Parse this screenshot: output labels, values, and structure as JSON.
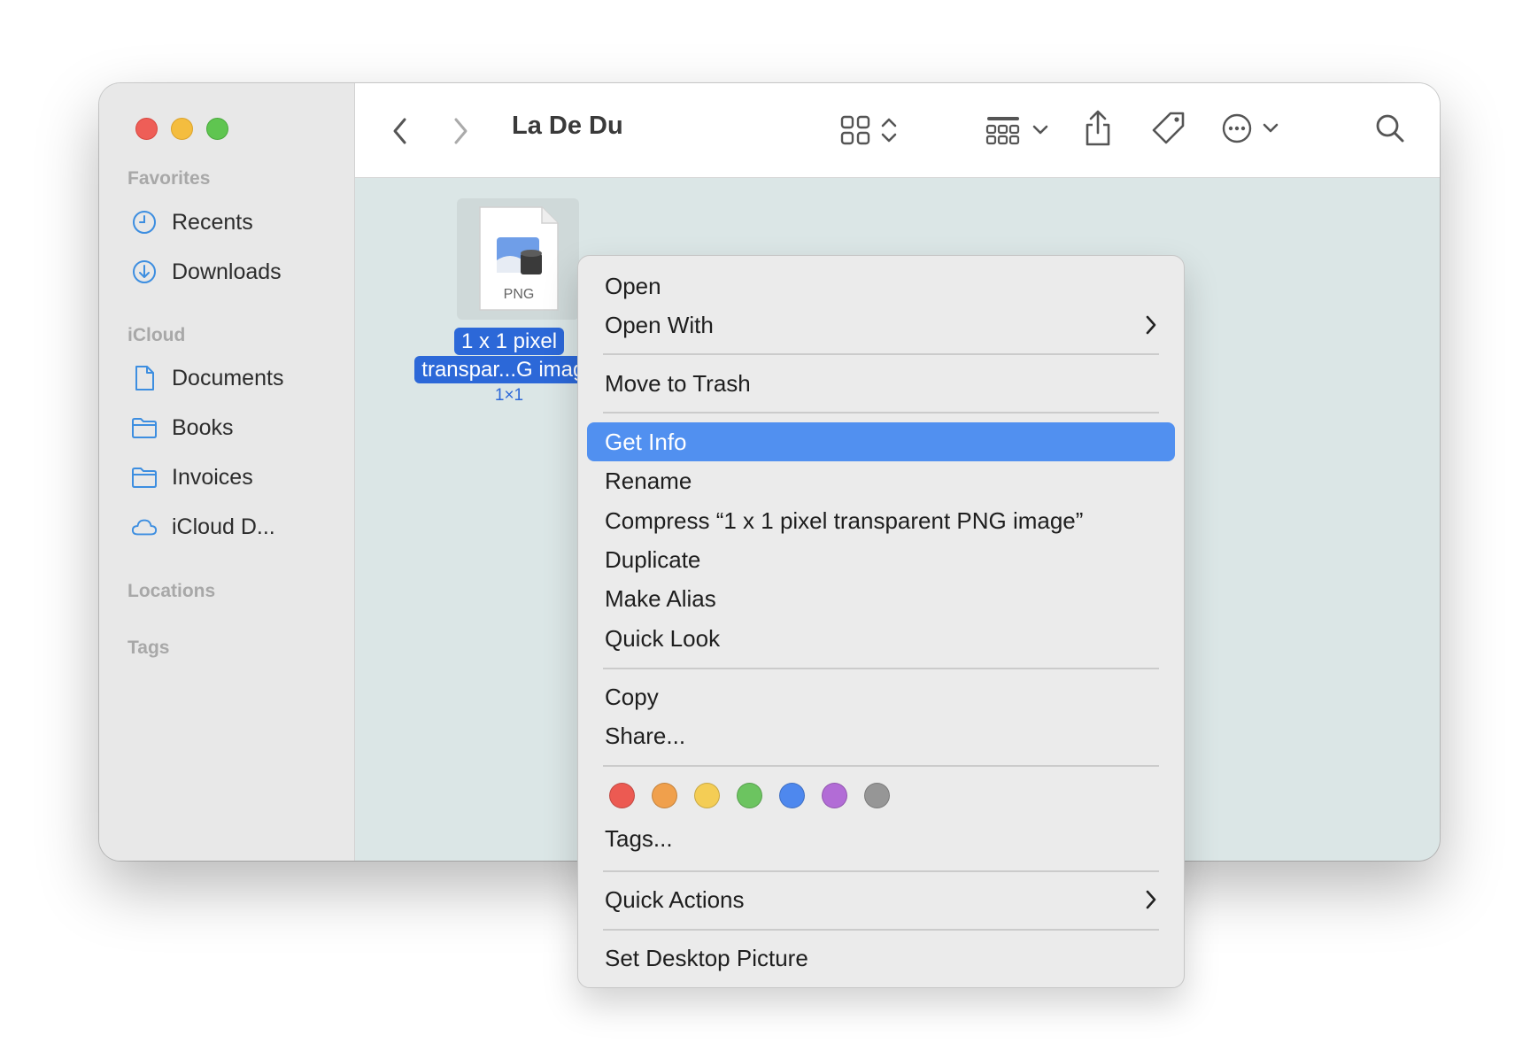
{
  "window": {
    "title": "La De Du"
  },
  "sidebar": {
    "sections": {
      "favorites": "Favorites",
      "icloud": "iCloud",
      "locations": "Locations",
      "tags": "Tags"
    },
    "favorites": [
      {
        "label": "Recents",
        "icon": "clock-icon"
      },
      {
        "label": "Downloads",
        "icon": "download-icon"
      }
    ],
    "icloud": [
      {
        "label": "Documents",
        "icon": "document-icon"
      },
      {
        "label": "Books",
        "icon": "folder-icon"
      },
      {
        "label": "Invoices",
        "icon": "folder-icon"
      },
      {
        "label": "iCloud D...",
        "icon": "cloud-icon"
      }
    ]
  },
  "file": {
    "type_label": "PNG",
    "name_line1": "1 x 1 pixel",
    "name_line2": "transpar...G image",
    "dimensions": "1×1"
  },
  "context_menu": {
    "open": "Open",
    "open_with": "Open With",
    "move_to_trash": "Move to Trash",
    "get_info": "Get Info",
    "rename": "Rename",
    "compress": "Compress “1 x 1 pixel transparent PNG image”",
    "duplicate": "Duplicate",
    "make_alias": "Make Alias",
    "quick_look": "Quick Look",
    "copy": "Copy",
    "share": "Share...",
    "tags": "Tags...",
    "quick_actions": "Quick Actions",
    "set_desktop_picture": "Set Desktop Picture",
    "highlighted": "Get Info",
    "tag_colors": [
      {
        "name": "red",
        "color": "#ec5a52"
      },
      {
        "name": "orange",
        "color": "#f0a04c"
      },
      {
        "name": "yellow",
        "color": "#f4cd55"
      },
      {
        "name": "green",
        "color": "#6cc460"
      },
      {
        "name": "blue",
        "color": "#4e88ee"
      },
      {
        "name": "purple",
        "color": "#b26cd6"
      },
      {
        "name": "gray",
        "color": "#969696"
      }
    ]
  },
  "colors": {
    "accent": "#2c68d8",
    "highlight": "#5190f0",
    "sidebar_icon": "#3d8ee0"
  }
}
